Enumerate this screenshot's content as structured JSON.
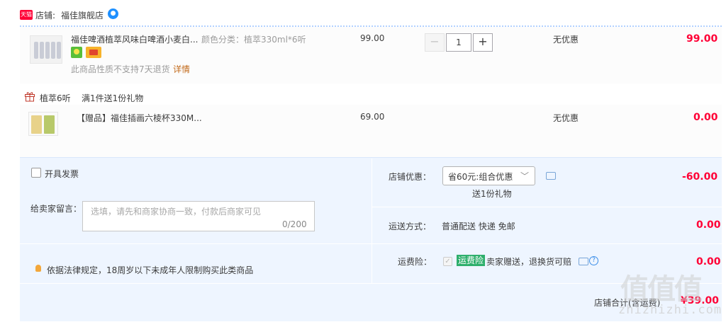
{
  "shop": {
    "badge": "天猫",
    "label": "店铺:",
    "name": "福佳旗舰店",
    "chat_icon": "wangwang-icon"
  },
  "items": [
    {
      "title": "福佳啤酒植萃风味白啤酒小麦白...",
      "sku": "颜色分类：植萃330ml*6听",
      "unit_price": "99.00",
      "quantity": "1",
      "discount": "无优惠",
      "subtotal": "99.00",
      "return_note": "此商品性质不支持7天退货",
      "detail_link": "详情"
    }
  ],
  "gift_group": {
    "label": "植萃6听",
    "rule": "满1件送1份礼物",
    "item": {
      "title": "【赠品】福佳插画六棱杯330M...",
      "unit_price": "69.00",
      "discount": "无优惠",
      "subtotal": "0.00"
    }
  },
  "order": {
    "invoice_label": "开具发票",
    "message_label": "给卖家留言：",
    "message_placeholder": "选填，请先和商家协商一致，付款后商家可见",
    "message_count": "0/200",
    "law_notice": "依据法律规定，18周岁以下未成年人限制购买此类商品",
    "promo_label": "店铺优惠：",
    "promo_selected": "省60元:组合优惠",
    "promo_gift": "送1份礼物",
    "promo_amount": "-60.00",
    "shipping_label": "运送方式：",
    "shipping_text": "普通配送 快递 免邮",
    "shipping_amount": "0.00",
    "insurance_label": "运费险：",
    "insurance_tag": "运费险",
    "insurance_text": "卖家赠送，退换货可赔",
    "insurance_amount": "0.00",
    "total_label": "店铺合计(含运费)",
    "total_amount": "¥39.00"
  },
  "watermark": {
    "glyphs": "值值值",
    "site": "zhizhizhi.com"
  },
  "colors": {
    "price_red": "#ff0036",
    "settings_bg": "#eef5ff",
    "link_orange": "#c26a1b",
    "insurance_green": "#2eaf6c"
  }
}
